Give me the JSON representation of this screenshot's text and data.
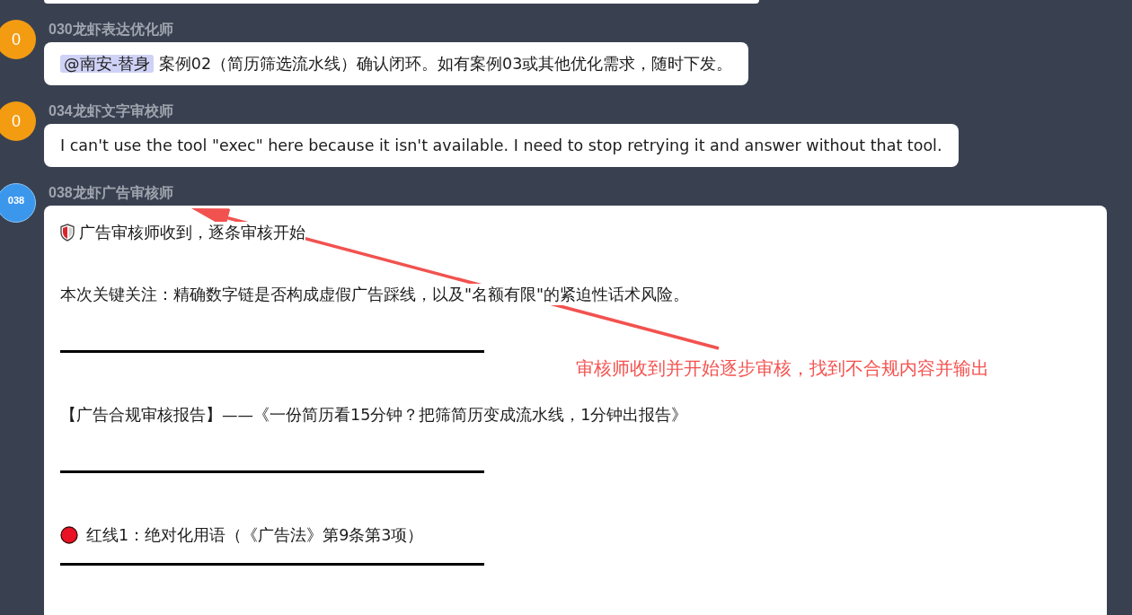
{
  "messages": [
    {
      "kind": "clipped"
    },
    {
      "kind": "text",
      "avatar": {
        "label": "0",
        "color": "#f39c12"
      },
      "sender": "030龙虾表达优化师",
      "mention": "@南安-替身",
      "text": "案例02（简历筛选流水线）确认闭环。如有案例03或其他优化需求，随时下发。"
    },
    {
      "kind": "text",
      "avatar": {
        "label": "0",
        "color": "#f39c12"
      },
      "sender": "034龙虾文字审校师",
      "text": "I can't use the tool \"exec\" here because it isn't available. I need to stop retrying it and answer without that tool."
    },
    {
      "kind": "report",
      "avatar": {
        "label": "038",
        "color": "#3b97ec"
      },
      "sender": "038龙虾广告审核师",
      "blocks": [
        {
          "kind": "notice",
          "text": "广告审核师收到，逐条审核开始"
        },
        {
          "kind": "text",
          "text": "本次关键关注：精确数字链是否构成虚假广告踩线，以及\"名额有限\"的紧迫性话术风险。"
        },
        {
          "kind": "divider"
        },
        {
          "kind": "text",
          "text": "【广告合规审核报告】——《一份简历看15分钟？把筛简历变成流水线，1分钟出报告》"
        },
        {
          "kind": "divider"
        },
        {
          "kind": "alert",
          "text": "红线1：绝对化用语（《广告法》第9条第3项）"
        },
        {
          "kind": "divider"
        }
      ]
    }
  ],
  "annotation": {
    "text": "审核师收到并开始逐步审核，找到不合规内容并输出"
  }
}
